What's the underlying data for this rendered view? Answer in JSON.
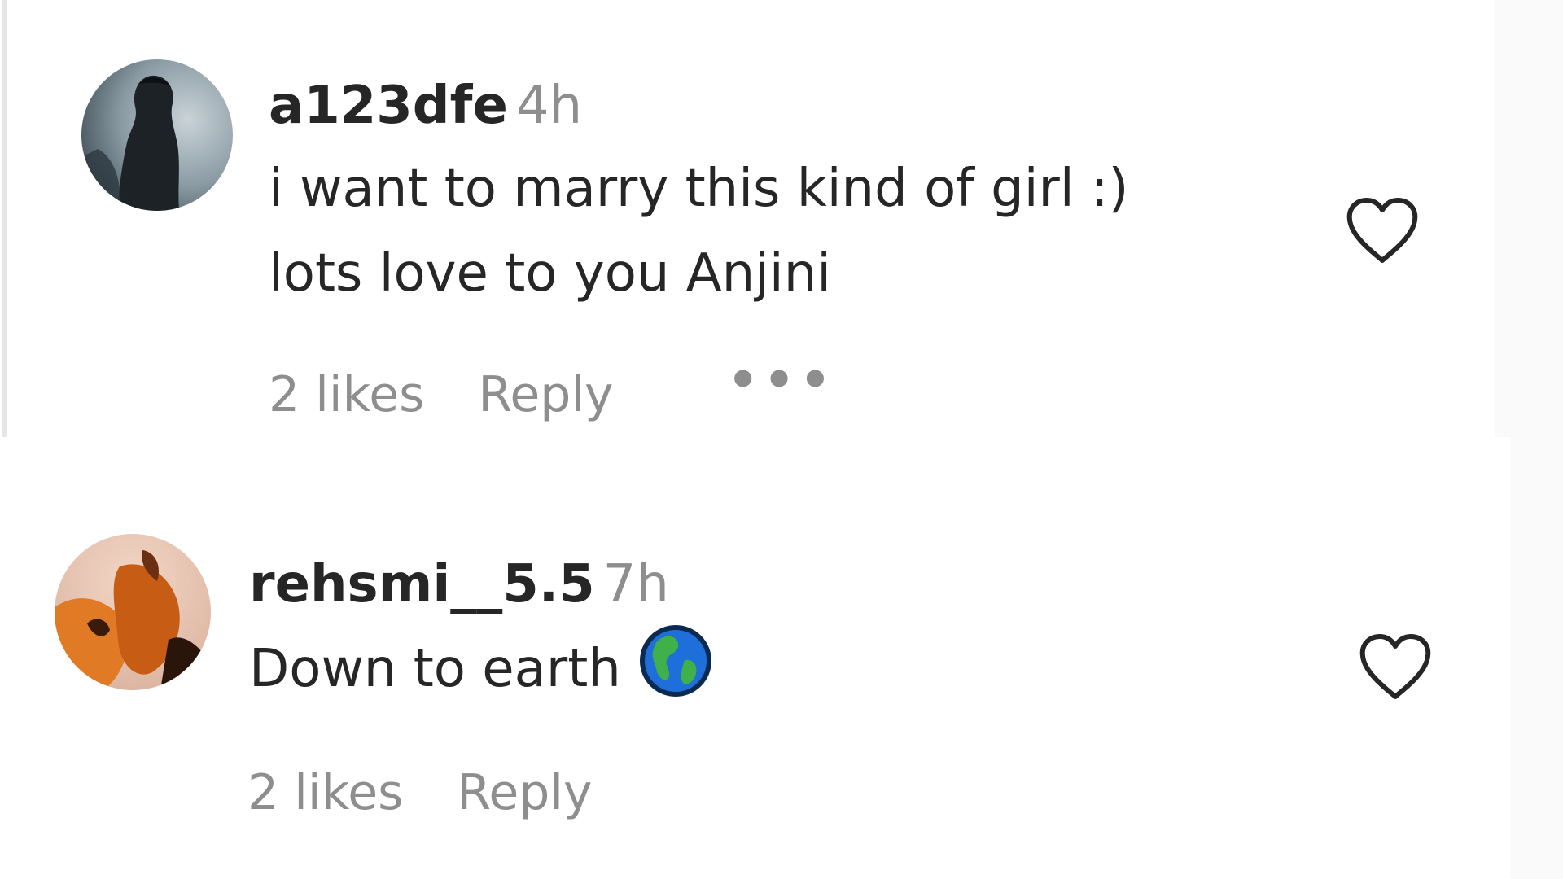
{
  "comments": [
    {
      "username": "a123dfe",
      "time": "4h",
      "text_lines": [
        "i want to marry this kind of girl :)",
        "lots love to you Anjini"
      ],
      "likes": "2 likes",
      "reply": "Reply",
      "more": "•••",
      "avatar_icon": "avatar-photo-dark-figure",
      "like_icon": "heart-outline-icon"
    },
    {
      "username": "rehsmi__5.5",
      "time": "7h",
      "text": "Down to earth",
      "emoji_icon": "globe-americas-icon",
      "likes": "2 likes",
      "reply": "Reply",
      "avatar_icon": "avatar-photo-orange-hands",
      "like_icon": "heart-outline-icon"
    }
  ],
  "colors": {
    "primary_text": "#262626",
    "secondary_text": "#8e8e8e",
    "background": "#ffffff"
  }
}
